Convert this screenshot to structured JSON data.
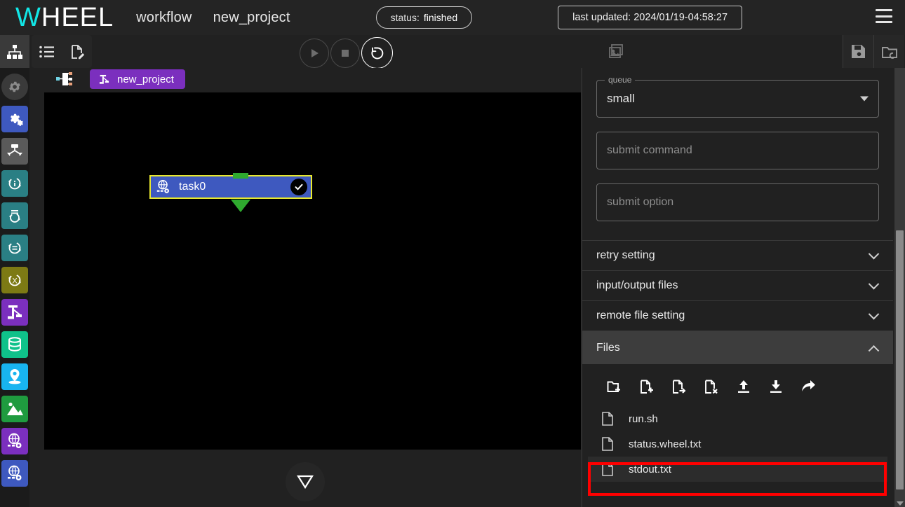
{
  "topbar": {
    "logo_w": "W",
    "logo_rest": "HEEL",
    "title": "workflow",
    "project": "new_project",
    "status_key": "status:",
    "status_value": "finished",
    "last_updated": "last updated: 2024/01/19-04:58:27",
    "menu_icon": "hamburger-menu-icon"
  },
  "rail": {
    "top_icon": "hierarchy-tree-icon",
    "items": [
      {
        "name": "gear-disabled-icon",
        "color": "#3a3a3a"
      },
      {
        "name": "double-gear-icon",
        "color": "#3e59bf"
      },
      {
        "name": "expand-arrows-icon",
        "color": "#5a5a5a"
      },
      {
        "name": "info-cycle-icon",
        "color": "#2a7f84"
      },
      {
        "name": "sync-list-icon",
        "color": "#2a7f84"
      },
      {
        "name": "sync-equals-icon",
        "color": "#2a7f84"
      },
      {
        "name": "cycle-x-icon",
        "color": "#7d7a14"
      },
      {
        "name": "workflow-graph-icon",
        "color": "#7b2fbe"
      },
      {
        "name": "database-icon",
        "color": "#0fc28a"
      },
      {
        "name": "location-pin-icon",
        "color": "#18b4f0"
      },
      {
        "name": "image-mountain-icon",
        "color": "#1f9b3f"
      },
      {
        "name": "globe-gear-purple-icon",
        "color": "#7b2fbe"
      },
      {
        "name": "globe-gear-blue-icon",
        "color": "#3e59bf"
      }
    ]
  },
  "toolbar": {
    "list_icon": "list-view-icon",
    "edit_doc_icon": "document-edit-icon",
    "play_label": "run-button",
    "stop_label": "stop-button",
    "reset_label": "reset-button",
    "image_icon": "gallery-image-icon",
    "save_icon": "save-disk-icon",
    "folder_icon": "open-folder-icon"
  },
  "tabs": {
    "home_icon": "project-tree-icon",
    "active": "new_project",
    "active_icon": "workflow-graph-icon"
  },
  "canvas": {
    "node": {
      "label": "task0",
      "icon": "globe-gear-icon",
      "status_icon": "check-circle-icon"
    },
    "drawer_toggle": "collapse-triangle-icon"
  },
  "properties": {
    "queue": {
      "legend": "queue",
      "value": "small"
    },
    "submit_command": {
      "placeholder": "submit command",
      "value": ""
    },
    "submit_option": {
      "placeholder": "submit option",
      "value": ""
    },
    "sections": [
      {
        "label": "retry setting",
        "expanded": false
      },
      {
        "label": "input/output files",
        "expanded": false
      },
      {
        "label": "remote file setting",
        "expanded": false
      },
      {
        "label": "Files",
        "expanded": true
      }
    ],
    "file_tools": [
      "new-folder-icon",
      "new-file-icon",
      "rename-file-icon",
      "delete-file-icon",
      "upload-icon",
      "download-icon",
      "share-icon"
    ],
    "files": [
      {
        "name": "run.sh",
        "selected": false
      },
      {
        "name": "status.wheel.txt",
        "selected": false
      },
      {
        "name": "stdout.txt",
        "selected": true
      }
    ]
  },
  "colors": {
    "accent_cyan": "#12e6e6",
    "accent_purple": "#7b2fbe",
    "node_blue": "#3e59bf",
    "node_border": "#e8e82e",
    "highlight_red": "#ff0000",
    "port_green": "#2faa2f"
  }
}
